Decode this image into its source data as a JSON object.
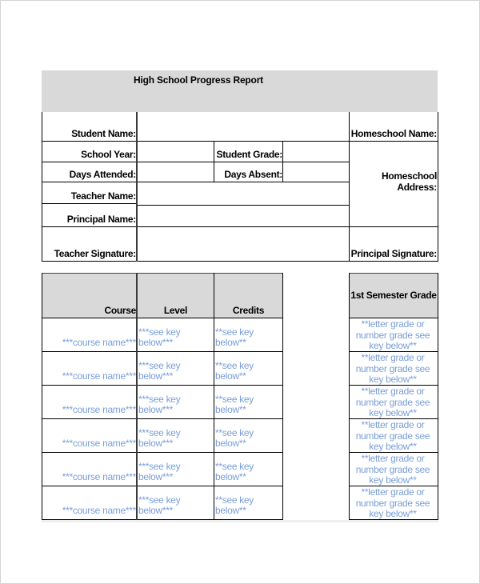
{
  "report": {
    "title": "High School Progress Report",
    "info_labels": {
      "student_name": "Student Name:",
      "school_year": "School Year:",
      "student_grade": "Student Grade:",
      "days_attended": "Days Attended:",
      "days_absent": "Days Absent:",
      "teacher_name": "Teacher Name:",
      "principal_name": "Principal Name:",
      "teacher_signature": "Teacher Signature:",
      "homeschool_name": "Homeschool Name:",
      "homeschool_address": "Homeschool Address:",
      "principal_signature": "Principal Signature:"
    },
    "info_values": {
      "student_name": "",
      "school_year": "",
      "student_grade": "",
      "days_attended": "",
      "days_absent": "",
      "teacher_name": "",
      "principal_name": "",
      "teacher_signature": ""
    }
  },
  "courses": {
    "headers": {
      "course": "Course",
      "level": "Level",
      "credits": "Credits",
      "semester_grade": "1st Semester Grade"
    },
    "placeholder_color": "#7a9ed8",
    "header_bg": "#d9d9d9",
    "rows": [
      {
        "course": "***course name***",
        "level": "***see key below***",
        "credits": "**see key below**",
        "grade": "**letter grade or number grade see key below**"
      },
      {
        "course": "***course name***",
        "level": "***see key below***",
        "credits": "**see key below**",
        "grade": "**letter grade or number grade see key below**"
      },
      {
        "course": "***course name***",
        "level": "***see key below***",
        "credits": "**see key below**",
        "grade": "**letter grade or number grade see key below**"
      },
      {
        "course": "***course name***",
        "level": "***see key below***",
        "credits": "**see key below**",
        "grade": "**letter grade or number grade see key below**"
      },
      {
        "course": "***course name***",
        "level": "***see key below***",
        "credits": "**see key below**",
        "grade": "**letter grade or number grade see key below**"
      },
      {
        "course": "***course name***",
        "level": "***see key below***",
        "credits": "**see key below**",
        "grade": "**letter grade or number grade see key below**"
      }
    ]
  }
}
